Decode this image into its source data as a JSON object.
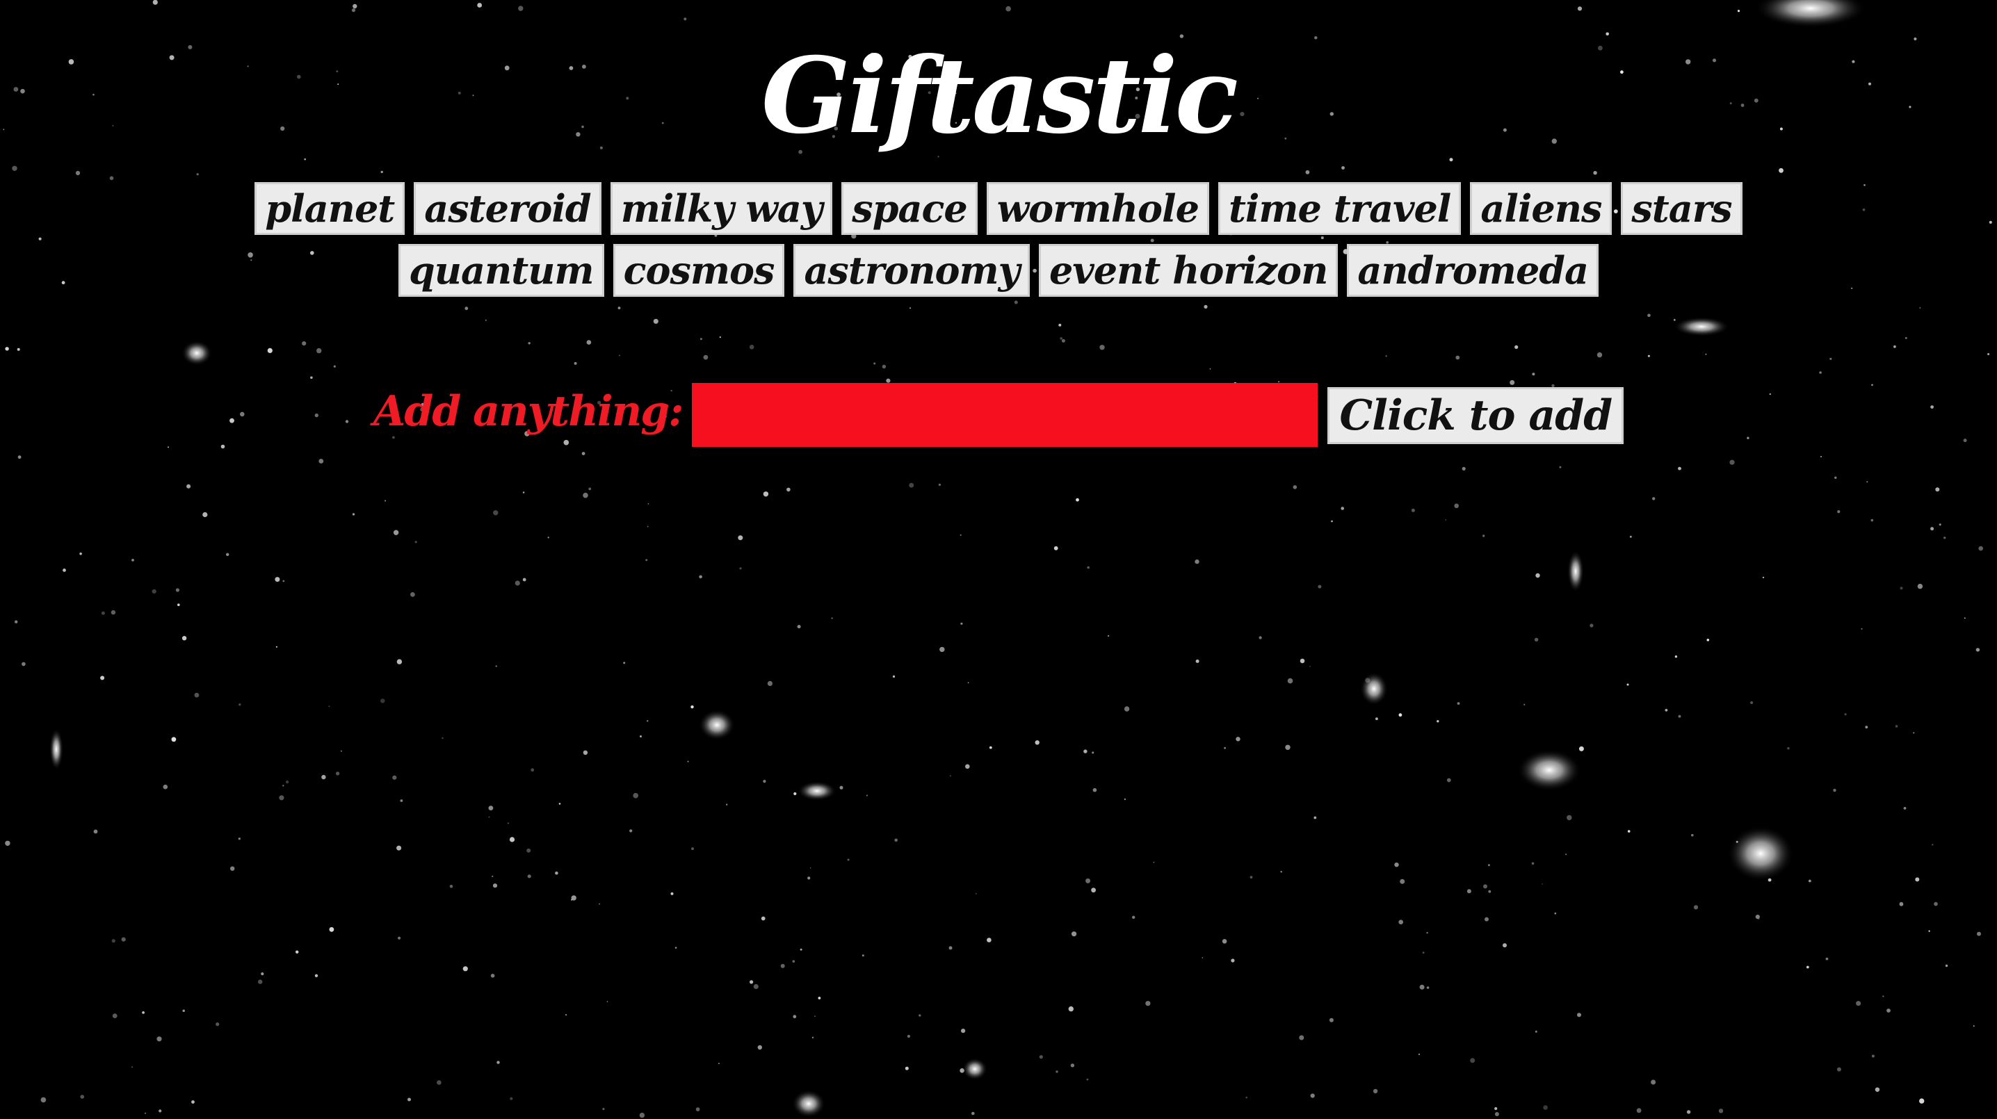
{
  "page": {
    "title": "Giftastic"
  },
  "topics": {
    "row1": [
      "planet",
      "asteroid",
      "milky way",
      "space",
      "wormhole",
      "time travel",
      "aliens",
      "stars"
    ],
    "row2": [
      "quantum",
      "cosmos",
      "astronomy",
      "event horizon",
      "andromeda"
    ]
  },
  "form": {
    "label": "Add anything:",
    "input_value": "",
    "button_label": "Click to add"
  },
  "colors": {
    "background": "#000000",
    "title": "#ffffff",
    "button_bg": "#ebebeb",
    "accent_red": "#f01b24",
    "input_bg": "#f50f1f"
  },
  "background_image": "star-field"
}
